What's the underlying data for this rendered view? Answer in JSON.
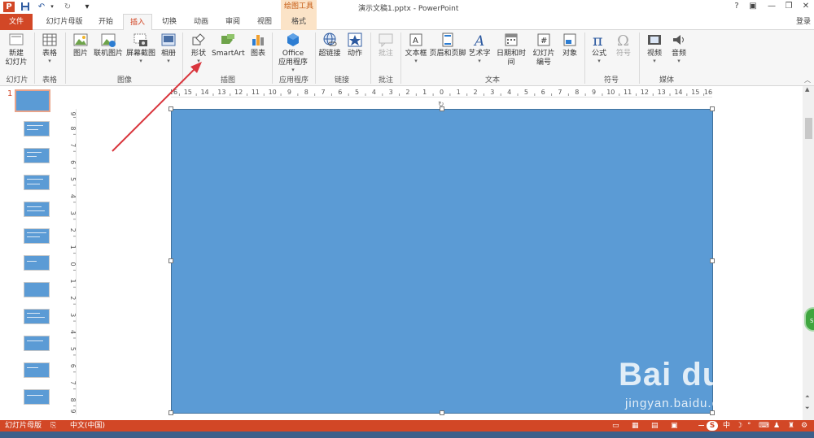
{
  "window": {
    "title": "演示文稿1.pptx - PowerPoint",
    "context_tab_group": "绘图工具",
    "help": "?",
    "controls": [
      "▣",
      "—",
      "❐",
      "✕"
    ]
  },
  "quick_access": {
    "app_icon": "P",
    "undo": "↶",
    "redo": "↻",
    "customize": "▾"
  },
  "tabs": [
    "文件",
    "幻灯片母版",
    "开始",
    "插入",
    "切换",
    "动画",
    "审阅",
    "视图",
    "格式"
  ],
  "active_tab": "插入",
  "login": "登录",
  "ribbon": {
    "slides": {
      "new_slide": "新建",
      "new_slide_2": "幻灯片",
      "group": "幻灯片"
    },
    "tables": {
      "table": "表格",
      "group": "表格"
    },
    "images": {
      "picture": "图片",
      "online_picture": "联机图片",
      "screenshot": "屏幕截图",
      "album": "相册",
      "group": "图像"
    },
    "illustrations": {
      "shapes": "形状",
      "smartart": "SmartArt",
      "chart": "图表",
      "group": "插图"
    },
    "apps": {
      "office_1": "Office",
      "office_2": "应用程序",
      "group": "应用程序"
    },
    "links": {
      "hyperlink": "超链接",
      "action": "动作",
      "group": "链接"
    },
    "comments": {
      "comment": "批注",
      "group": "批注"
    },
    "text": {
      "textbox": "文本框",
      "header_footer": "页眉和页脚",
      "wordart": "艺术字",
      "datetime": "日期和时间",
      "slide_num_1": "幻灯片",
      "slide_num_2": "编号",
      "object": "对象",
      "group": "文本"
    },
    "symbols": {
      "equation": "公式",
      "symbol": "符号",
      "group": "符号"
    },
    "media": {
      "video": "视频",
      "audio": "音频",
      "group": "媒体"
    }
  },
  "ruler_labels": {
    "h": [
      "16",
      "15",
      "14",
      "13",
      "12",
      "11",
      "10",
      "9",
      "8",
      "7",
      "6",
      "5",
      "4",
      "3",
      "2",
      "1",
      "0",
      "1",
      "2",
      "3",
      "4",
      "5",
      "6",
      "7",
      "8",
      "9",
      "10",
      "11",
      "12",
      "13",
      "14",
      "15",
      "16"
    ],
    "v": [
      "9",
      "8",
      "7",
      "6",
      "5",
      "4",
      "3",
      "2",
      "1",
      "0",
      "1",
      "2",
      "3",
      "4",
      "5",
      "6",
      "7",
      "8",
      "9"
    ]
  },
  "slide_panel": {
    "current_slide_number": "1",
    "thumbnail_count": 12
  },
  "status_bar": {
    "view": "幻灯片母版",
    "language": "中文(中国)",
    "zoom_minus": "−"
  },
  "watermark": {
    "main": "Bai du 经验",
    "url": "jingyan.baidu.com"
  },
  "badge": {
    "text": "SB"
  },
  "colors": {
    "accent": "#d24726",
    "shape_fill": "#5b9bd5",
    "arrow": "#d9363e"
  }
}
